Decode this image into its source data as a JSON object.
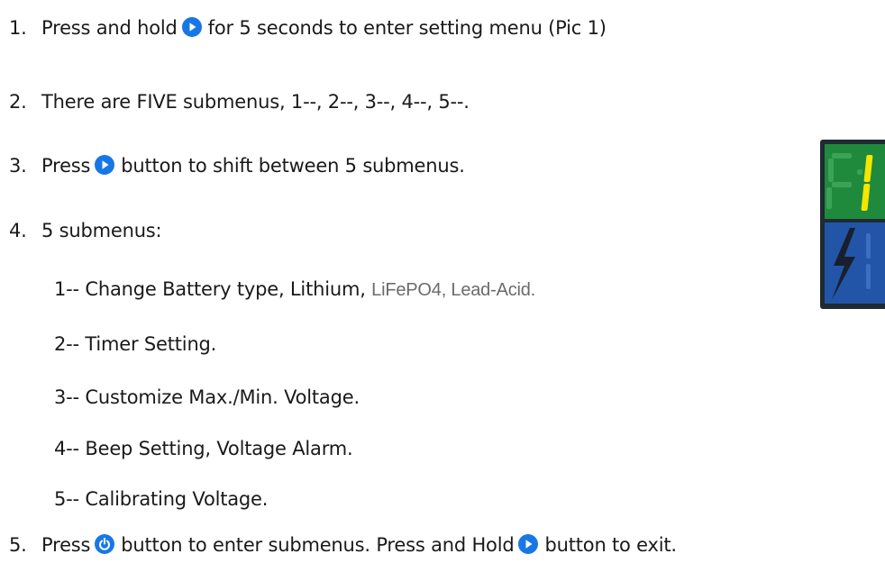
{
  "steps": {
    "s1": {
      "num": "1.",
      "pre": "Press and hold",
      "post": "for 5 seconds to enter setting menu (Pic 1)"
    },
    "s2": {
      "num": "2.",
      "text": "There are FIVE submenus, 1--, 2--, 3--, 4--, 5--."
    },
    "s3": {
      "num": "3.",
      "pre": "Press",
      "post": "button to shift between 5 submenus."
    },
    "s4": {
      "num": "4.",
      "text": "5 submenus:"
    },
    "s5": {
      "num": "5.",
      "pre": "Press",
      "mid": "button to enter submenus. Press and Hold",
      "post": "button to exit."
    }
  },
  "submenus": [
    {
      "text": "1-- Change Battery type, Lithium,",
      "extra": "LiFePO4, Lead-Acid."
    },
    {
      "text": "2-- Timer Setting."
    },
    {
      "text": "3-- Customize Max./Min. Voltage."
    },
    {
      "text": "4-- Beep Setting, Voltage Alarm."
    },
    {
      "text": "5-- Calibrating Voltage."
    }
  ],
  "icons": {
    "play_button": "play-circle-icon",
    "power_button": "power-circle-icon",
    "button_color": "#1877e6",
    "lightning": "lightning-bolt-icon"
  },
  "display_colors": {
    "frame": "#1f2a33",
    "top_panel": "#1f8a3c",
    "bottom_panel": "#2255a8",
    "digit": "#f5e600"
  }
}
